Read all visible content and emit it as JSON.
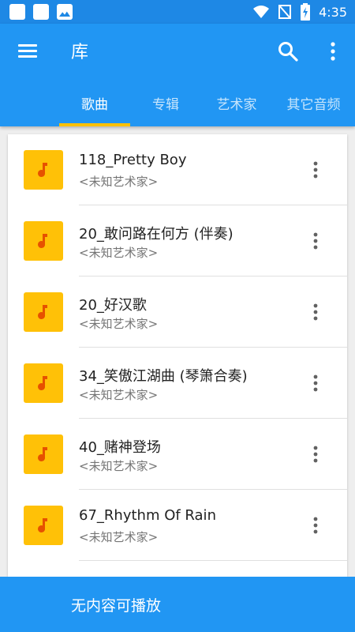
{
  "status_bar": {
    "time": "4:35",
    "icons": [
      "notification-icon",
      "notification-icon",
      "image-notification-icon",
      "wifi-icon",
      "no-signal-icon",
      "battery-charging-icon"
    ]
  },
  "app_bar": {
    "title": "库",
    "menu_icon": "menu-icon",
    "search_icon": "search-icon",
    "more_icon": "more-vert-icon"
  },
  "tabs": [
    {
      "label": "歌曲",
      "active": true
    },
    {
      "label": "专辑",
      "active": false
    },
    {
      "label": "艺术家",
      "active": false
    },
    {
      "label": "其它音频",
      "active": false
    }
  ],
  "colors": {
    "primary": "#2196f3",
    "status_bar": "#1e88e5",
    "accent": "#ffc107",
    "album_art_note": "#e65100"
  },
  "songs": [
    {
      "title": "118_Pretty Boy",
      "artist": "<未知艺术家>"
    },
    {
      "title": "20_敢问路在何方 (伴奏)",
      "artist": "<未知艺术家>"
    },
    {
      "title": "20_好汉歌",
      "artist": "<未知艺术家>"
    },
    {
      "title": "34_笑傲江湖曲 (琴箫合奏)",
      "artist": "<未知艺术家>"
    },
    {
      "title": "40_赌神登场",
      "artist": "<未知艺术家>"
    },
    {
      "title": "67_Rhythm Of Rain",
      "artist": "<未知艺术家>"
    }
  ],
  "bottom_bar": {
    "text": "无内容可播放"
  }
}
